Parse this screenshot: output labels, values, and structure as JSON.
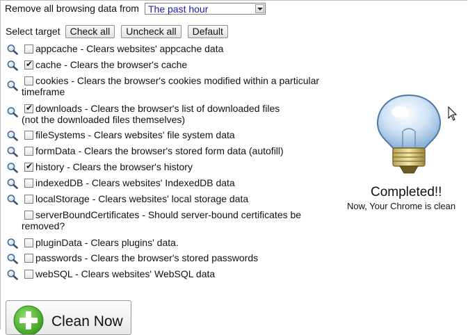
{
  "range": {
    "label": "Remove all browsing data from",
    "selected": "The past hour"
  },
  "target": {
    "label": "Select target",
    "check_all": "Check all",
    "uncheck_all": "Uncheck all",
    "default": "Default"
  },
  "items": [
    {
      "text": "appcache - Clears websites' appcache data",
      "checked": false,
      "has_icon": true
    },
    {
      "text": "cache - Clears the browser's cache",
      "checked": true,
      "has_icon": true
    },
    {
      "text": "cookies - Clears the browser's cookies modified within a particular timeframe",
      "checked": false,
      "has_icon": true
    },
    {
      "text": "downloads - Clears the browser's list of downloaded files (not the downloaded files themselves)",
      "checked": true,
      "has_icon": true
    },
    {
      "text": "fileSystems - Clears websites' file system data",
      "checked": false,
      "has_icon": true
    },
    {
      "text": "formData - Clears the browser's stored form data (autofill)",
      "checked": false,
      "has_icon": true
    },
    {
      "text": "history - Clears the browser's history",
      "checked": true,
      "has_icon": true
    },
    {
      "text": "indexedDB - Clears websites' IndexedDB data",
      "checked": false,
      "has_icon": true
    },
    {
      "text": "localStorage - Clears websites' local storage data",
      "checked": false,
      "has_icon": true
    },
    {
      "text": "serverBoundCertificates - Should server-bound certificates be removed?",
      "checked": false,
      "has_icon": false
    },
    {
      "text": "pluginData - Clears plugins' data.",
      "checked": false,
      "has_icon": true
    },
    {
      "text": "passwords - Clears the browser's stored passwords",
      "checked": false,
      "has_icon": true
    },
    {
      "text": "webSQL - Clears websites' WebSQL data",
      "checked": false,
      "has_icon": true
    }
  ],
  "status": {
    "title": "Completed!!",
    "subtitle": "Now, Your Chrome is clean",
    "icon": "lightbulb-icon"
  },
  "clean": {
    "label": "Clean Now",
    "icon": "plus-circle-icon",
    "icon_color": "#4caf2a"
  },
  "colors": {
    "select_text": "#1a1aa6",
    "border": "#bdbdbd"
  }
}
